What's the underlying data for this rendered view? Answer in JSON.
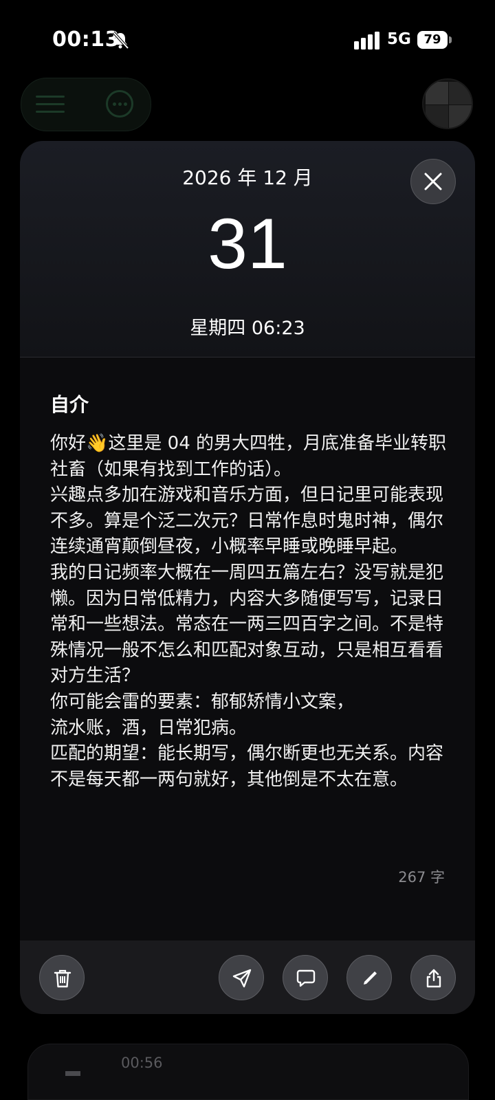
{
  "status_bar": {
    "time": "00:13",
    "network": "5G",
    "battery": "79",
    "icons": [
      "bell-muted-icon",
      "signal-icon",
      "battery-icon"
    ]
  },
  "top_bar": {
    "icons": [
      "menu-icon",
      "more-icon",
      "avatar"
    ]
  },
  "entry": {
    "month": "2026 年 12 月",
    "day": "31",
    "weekday_time": "星期四  06:23",
    "title": "自介",
    "body_start": "你好",
    "emoji": "👋",
    "body": "这里是 04 的男大四牲，月底准备毕业转职社畜（如果有找到工作的话）。\n兴趣点多加在游戏和音乐方面，但日记里可能表现不多。算是个泛二次元？日常作息时鬼时神，偶尔连续通宵颠倒昼夜，小概率早睡或晚睡早起。\n我的日记频率大概在一周四五篇左右？没写就是犯懒。因为日常低精力，内容大多随便写写，记录日常和一些想法。常态在一两三四百字之间。不是特殊情况一般不怎么和匹配对象互动，只是相互看看对方生活？\n你可能会雷的要素：郁郁矫情小文案，\n流水账，酒，日常犯病。\n匹配的期望：能长期写，偶尔断更也无关系。内容不是每天都一两句就好，其他倒是不太在意。",
    "word_count": "267 字"
  },
  "toolbar": {
    "icons": [
      "trash-icon",
      "send-icon",
      "comment-icon",
      "pencil-icon",
      "share-icon"
    ]
  },
  "next_entry": {
    "time": "00:56"
  },
  "colors": {
    "background": "#000000",
    "card": "#0c0c0e",
    "button": "#404146"
  }
}
